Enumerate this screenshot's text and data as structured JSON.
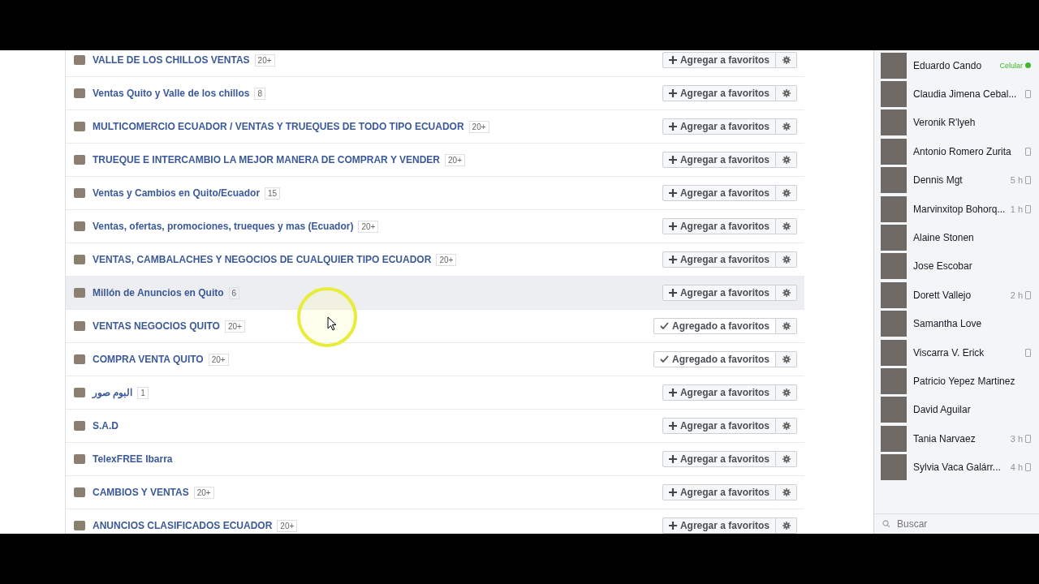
{
  "groups": [
    {
      "name": "VALLE DE LOS CHILLOS VENTAS",
      "count": "20+",
      "hovered": false,
      "favorited": false,
      "button": "Agregar a favoritos"
    },
    {
      "name": "Ventas Quito y Valle de los chillos",
      "count": "8",
      "hovered": false,
      "favorited": false,
      "button": "Agregar a favoritos"
    },
    {
      "name": "MULTICOMERCIO ECUADOR / VENTAS Y TRUEQUES DE TODO TIPO ECUADOR",
      "count": "20+",
      "hovered": false,
      "favorited": false,
      "button": "Agregar a favoritos"
    },
    {
      "name": "TRUEQUE E INTERCAMBIO LA MEJOR MANERA DE COMPRAR Y VENDER",
      "count": "20+",
      "hovered": false,
      "favorited": false,
      "button": "Agregar a favoritos"
    },
    {
      "name": "Ventas y Cambios en Quito/Ecuador",
      "count": "15",
      "hovered": false,
      "favorited": false,
      "button": "Agregar a favoritos"
    },
    {
      "name": "Ventas, ofertas, promociones, trueques y mas (Ecuador)",
      "count": "20+",
      "hovered": false,
      "favorited": false,
      "button": "Agregar a favoritos"
    },
    {
      "name": "VENTAS, CAMBALACHES Y NEGOCIOS DE CUALQUIER TIPO ECUADOR",
      "count": "20+",
      "hovered": false,
      "favorited": false,
      "button": "Agregar a favoritos"
    },
    {
      "name": "Millón de Anuncios en Quito",
      "count": "6",
      "hovered": true,
      "favorited": false,
      "button": "Agregar a favoritos"
    },
    {
      "name": "VENTAS NEGOCIOS QUITO",
      "count": "20+",
      "hovered": false,
      "favorited": true,
      "button": "Agregado a favoritos"
    },
    {
      "name": "COMPRA VENTA QUITO",
      "count": "20+",
      "hovered": false,
      "favorited": true,
      "button": "Agregado a favoritos"
    },
    {
      "name": "البوم صور",
      "count": "1",
      "hovered": false,
      "favorited": false,
      "button": "Agregar a favoritos"
    },
    {
      "name": "S.A.D",
      "hovered": false,
      "favorited": false,
      "button": "Agregar a favoritos"
    },
    {
      "name": "TelexFREE Ibarra",
      "hovered": false,
      "favorited": false,
      "button": "Agregar a favoritos"
    },
    {
      "name": "CAMBIOS Y VENTAS",
      "count": "20+",
      "hovered": false,
      "favorited": false,
      "button": "Agregar a favoritos"
    },
    {
      "name": "ANUNCIOS CLASIFICADOS ECUADOR",
      "count": "20+",
      "hovered": false,
      "favorited": false,
      "button": "Agregar a favoritos"
    }
  ],
  "chat": {
    "contacts": [
      {
        "name": "Eduardo Cando",
        "status": "Celular",
        "online": true,
        "mobile": false
      },
      {
        "name": "Claudia Jimena Cebal...",
        "online": false,
        "mobile": true
      },
      {
        "name": "Veronik R'lyeh",
        "online": false,
        "mobile": false
      },
      {
        "name": "Antonio Romero Zurita",
        "online": false,
        "mobile": true
      },
      {
        "name": "Dennis Mgt",
        "status": "5 h",
        "online": false,
        "mobile": true
      },
      {
        "name": "Marvinxitop Bohorq...",
        "status": "1 h",
        "online": false,
        "mobile": true
      },
      {
        "name": "Alaine Stonen",
        "online": false,
        "mobile": false
      },
      {
        "name": "Jose Escobar",
        "online": false,
        "mobile": false
      },
      {
        "name": "Dorett Vallejo",
        "status": "2 h",
        "online": false,
        "mobile": true
      },
      {
        "name": "Samantha Love",
        "online": false,
        "mobile": false
      },
      {
        "name": "Viscarra V. Erick",
        "online": false,
        "mobile": true
      },
      {
        "name": "Patricio Yepez Martinez",
        "online": false,
        "mobile": false
      },
      {
        "name": "David Aguilar",
        "online": false,
        "mobile": false
      },
      {
        "name": "Tania Narvaez",
        "status": "3 h",
        "online": false,
        "mobile": true
      },
      {
        "name": "Sylvia Vaca Galárr...",
        "status": "4 h",
        "online": false,
        "mobile": true
      }
    ],
    "search": {
      "placeholder": "Buscar"
    }
  }
}
